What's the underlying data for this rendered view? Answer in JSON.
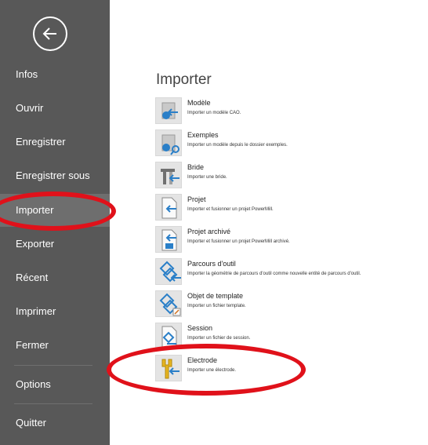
{
  "sidebar": {
    "items": [
      {
        "label": "Infos"
      },
      {
        "label": "Ouvrir"
      },
      {
        "label": "Enregistrer"
      },
      {
        "label": "Enregistrer sous"
      },
      {
        "label": "Importer"
      },
      {
        "label": "Exporter"
      },
      {
        "label": "Récent"
      },
      {
        "label": "Imprimer"
      },
      {
        "label": "Fermer"
      },
      {
        "label": "Options"
      },
      {
        "label": "Quitter"
      }
    ],
    "active": "Importer"
  },
  "main": {
    "title": "Importer",
    "items": [
      {
        "title": "Modèle",
        "desc": "Importer un modèle CAO.",
        "icon": "model-import-icon"
      },
      {
        "title": "Exemples",
        "desc": "Importer un modèle depuis le dossier exemples.",
        "icon": "examples-import-icon"
      },
      {
        "title": "Bride",
        "desc": "Importer une bride.",
        "icon": "clamp-import-icon"
      },
      {
        "title": "Projet",
        "desc": "Importer et fusionner un projet PowerMill.",
        "icon": "project-import-icon"
      },
      {
        "title": "Projet archivé",
        "desc": "Importer et fusionner un projet PowerMill archivé.",
        "icon": "archived-project-import-icon"
      },
      {
        "title": "Parcours d'outil",
        "desc": "Importer la géométrie de parcours d'outil comme nouvelle entité de parcours d'outil.",
        "icon": "toolpath-import-icon"
      },
      {
        "title": "Objet de template",
        "desc": "Importer un fichier template.",
        "icon": "template-import-icon"
      },
      {
        "title": "Session",
        "desc": "Importer un fichier de session.",
        "icon": "session-import-icon"
      },
      {
        "title": "Electrode",
        "desc": "Importer une électrode.",
        "icon": "electrode-import-icon"
      }
    ]
  },
  "colors": {
    "sidebar_bg": "#585858",
    "sidebar_active_bg": "#6e6e6e",
    "icon_blue": "#2a7fc8",
    "annotation_red": "#e0111a"
  }
}
